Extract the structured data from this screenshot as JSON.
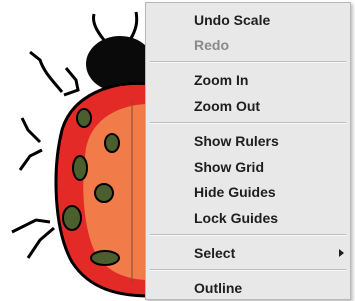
{
  "context_menu": {
    "items": [
      {
        "label": "Undo Scale",
        "enabled": true
      },
      {
        "label": "Redo",
        "enabled": false
      },
      {
        "label": "Zoom In",
        "enabled": true
      },
      {
        "label": "Zoom Out",
        "enabled": true
      },
      {
        "label": "Show Rulers",
        "enabled": true
      },
      {
        "label": "Show Grid",
        "enabled": true
      },
      {
        "label": "Hide Guides",
        "enabled": true
      },
      {
        "label": "Lock Guides",
        "enabled": true
      },
      {
        "label": "Select",
        "enabled": true,
        "has_submenu": true
      },
      {
        "label": "Outline",
        "enabled": true
      }
    ]
  },
  "artwork": {
    "subject": "ladybug-icon",
    "colors": {
      "shell_outer": "#e42a26",
      "shell_inner": "#f27b4a",
      "spots": "#4a5e2e",
      "head": "#0a0a0a"
    }
  }
}
